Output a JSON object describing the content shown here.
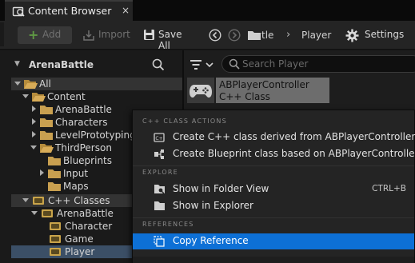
{
  "title_tab": {
    "label": "Content Browser",
    "icon": "content-browser-icon",
    "close": "×"
  },
  "toolbar": {
    "add_label": "Add",
    "import_label": "Import",
    "save_all_label": "Save All",
    "breadcrumb_prev": "tle",
    "breadcrumb_sep": "›",
    "breadcrumb_current": "Player",
    "settings_label": "Settings"
  },
  "sources": {
    "title": "ArenaBattle",
    "tree": [
      {
        "label": "All",
        "expanded": true,
        "kind": "folder"
      },
      {
        "label": "Content",
        "expanded": true,
        "kind": "folder"
      },
      {
        "label": "ArenaBattle",
        "expanded": false,
        "kind": "folder"
      },
      {
        "label": "Characters",
        "expanded": false,
        "kind": "folder"
      },
      {
        "label": "LevelPrototyping",
        "expanded": false,
        "kind": "folder"
      },
      {
        "label": "ThirdPerson",
        "expanded": true,
        "kind": "folder"
      },
      {
        "label": "Blueprints",
        "expanded": null,
        "kind": "folder"
      },
      {
        "label": "Input",
        "expanded": false,
        "kind": "folder"
      },
      {
        "label": "Maps",
        "expanded": null,
        "kind": "folder"
      },
      {
        "label": "C++ Classes",
        "expanded": true,
        "kind": "cpp"
      },
      {
        "label": "ArenaBattle",
        "expanded": true,
        "kind": "cpp"
      },
      {
        "label": "Character",
        "expanded": null,
        "kind": "cpp"
      },
      {
        "label": "Game",
        "expanded": null,
        "kind": "cpp"
      },
      {
        "label": "Player",
        "expanded": null,
        "kind": "cpp"
      }
    ]
  },
  "assets": {
    "search_placeholder": "Search Player",
    "items": [
      {
        "name": "ABPlayerController",
        "type": "C++ Class",
        "icon": "gamepad-icon"
      }
    ]
  },
  "context_menu": {
    "sections": [
      {
        "title": "C++ CLASS ACTIONS"
      },
      {
        "title": "EXPLORE"
      },
      {
        "title": "REFERENCES"
      }
    ],
    "items": [
      {
        "label": "Create C++ class derived from ABPlayerController",
        "icon": "cpp-class-icon",
        "shortcut": ""
      },
      {
        "label": "Create Blueprint class based on ABPlayerController",
        "icon": "blueprint-class-icon",
        "shortcut": ""
      },
      {
        "label": "Show in Folder View",
        "icon": "folder-view-icon",
        "shortcut": "CTRL+B"
      },
      {
        "label": "Show in Explorer",
        "icon": "explorer-folder-icon",
        "shortcut": ""
      },
      {
        "label": "Copy Reference",
        "icon": "copy-reference-icon",
        "shortcut": ""
      }
    ],
    "highlighted_item": "Copy Reference"
  },
  "colors": {
    "selection_blue": "#0d70d6",
    "folder": "#c9a050",
    "add_plus": "#5f9944"
  }
}
